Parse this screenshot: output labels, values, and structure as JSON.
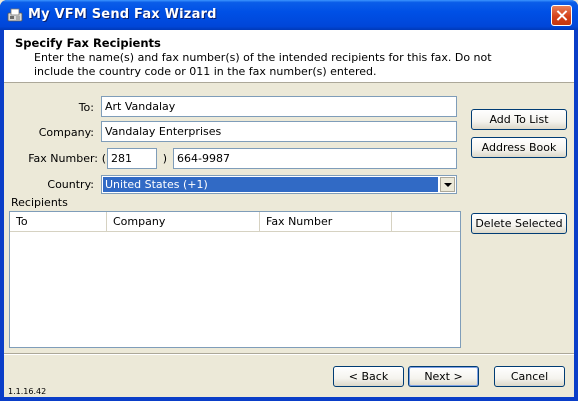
{
  "window": {
    "title": "My VFM Send Fax Wizard"
  },
  "header": {
    "title": "Specify Fax Recipients",
    "description": "Enter the name(s) and fax number(s) of the intended recipients for this fax.  Do not include the country code or 011 in the fax number(s) entered."
  },
  "form": {
    "to_label": "To:",
    "to_value": "Art Vandalay",
    "company_label": "Company:",
    "company_value": "Vandalay Enterprises",
    "fax_label": "Fax Number:",
    "paren_open": "(",
    "paren_close": ")",
    "area_code": "281",
    "fax_number": "664-9987",
    "country_label": "Country:",
    "country_value": "United States (+1)"
  },
  "buttons": {
    "add_to_list": "Add To List",
    "address_book": "Address Book",
    "delete_selected": "Delete Selected",
    "back": "< Back",
    "next": "Next >",
    "cancel": "Cancel"
  },
  "recipients": {
    "label": "Recipients",
    "columns": [
      "To",
      "Company",
      "Fax Number"
    ],
    "rows": []
  },
  "footer": {
    "version": "1.1.16.42"
  },
  "icons": {
    "title_icon": "fax-icon",
    "close": "close-icon"
  },
  "colors": {
    "titlebar": "#0050e6",
    "selection": "#316ac5",
    "dialog_bg": "#ece9d8"
  }
}
